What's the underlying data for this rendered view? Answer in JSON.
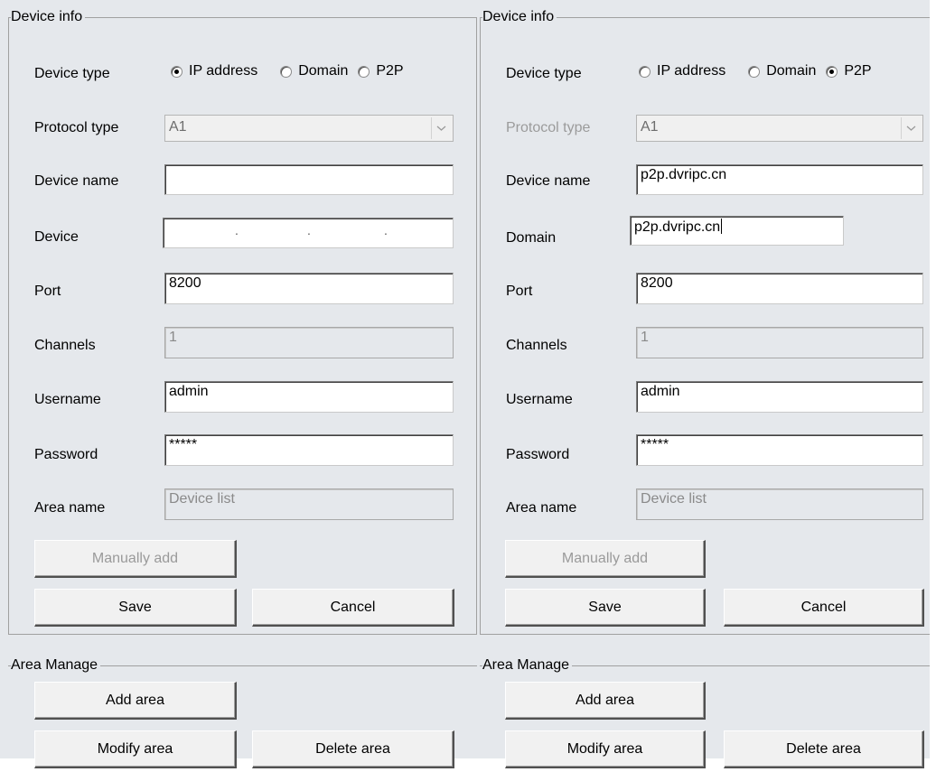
{
  "left_panel": {
    "device_info": {
      "title": "Device info",
      "device_type_label": "Device type",
      "device_type_options": [
        {
          "label": "IP address",
          "checked": true
        },
        {
          "label": "Domain",
          "checked": false
        },
        {
          "label": "P2P",
          "checked": false
        }
      ],
      "protocol_type_label": "Protocol type",
      "protocol_type_value": "A1",
      "device_name_label": "Device name",
      "device_name_value": "",
      "device_label": "Device",
      "ip_value": [
        ".",
        ".",
        "."
      ],
      "port_label": "Port",
      "port_value": "8200",
      "channels_label": "Channels",
      "channels_value": "1",
      "username_label": "Username",
      "username_value": "admin",
      "password_label": "Password",
      "password_value": "*****",
      "area_name_label": "Area name",
      "area_name_value": "Device list",
      "manually_add_label": "Manually add",
      "save_label": "Save",
      "cancel_label": "Cancel"
    },
    "area_manage": {
      "title": "Area Manage",
      "add_area_label": "Add area",
      "modify_area_label": "Modify area",
      "delete_area_label": "Delete area"
    }
  },
  "right_panel": {
    "device_info": {
      "title": "Device info",
      "device_type_label": "Device type",
      "device_type_options": [
        {
          "label": "IP address",
          "checked": false
        },
        {
          "label": "Domain",
          "checked": false
        },
        {
          "label": "P2P",
          "checked": true
        }
      ],
      "protocol_type_label": "Protocol type",
      "protocol_type_value": "A1",
      "device_name_label": "Device name",
      "device_name_value": "p2p.dvripc.cn",
      "domain_label": "Domain",
      "domain_value": "p2p.dvripc.cn",
      "port_label": "Port",
      "port_value": "8200",
      "channels_label": "Channels",
      "channels_value": "1",
      "username_label": "Username",
      "username_value": "admin",
      "password_label": "Password",
      "password_value": "*****",
      "area_name_label": "Area name",
      "area_name_value": "Device list",
      "manually_add_label": "Manually add",
      "save_label": "Save",
      "cancel_label": "Cancel"
    },
    "area_manage": {
      "title": "Area Manage",
      "add_area_label": "Add area",
      "modify_area_label": "Modify area",
      "delete_area_label": "Delete area"
    }
  },
  "icons": {
    "combo_arrow": "chevron-down-icon",
    "radio": "radio-button-icon"
  }
}
